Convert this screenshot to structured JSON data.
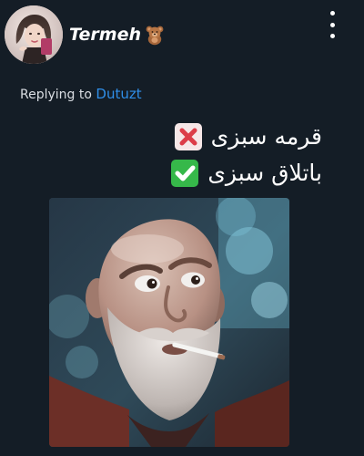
{
  "header": {
    "username": "Termeh",
    "username_emoji": "teddy-bear-emoji",
    "avatar_icon": "profile-avatar",
    "more_icon": "vertical-ellipsis-icon"
  },
  "reply": {
    "label": "Replying to",
    "handle": "Dutuzt"
  },
  "tweet": {
    "lines": [
      {
        "text": "قرمه سبزی",
        "emoji": "cross-mark-emoji"
      },
      {
        "text": "باتلاق سبزی",
        "emoji": "check-mark-emoji"
      }
    ]
  },
  "media": {
    "kind": "photo",
    "subject_icon": "bald-bearded-man-with-cigarette"
  },
  "colors": {
    "background": "#141d26",
    "text": "#ffffff",
    "link": "#2f8ee8",
    "check": "#36b84a",
    "cross": "#dc3d48"
  }
}
